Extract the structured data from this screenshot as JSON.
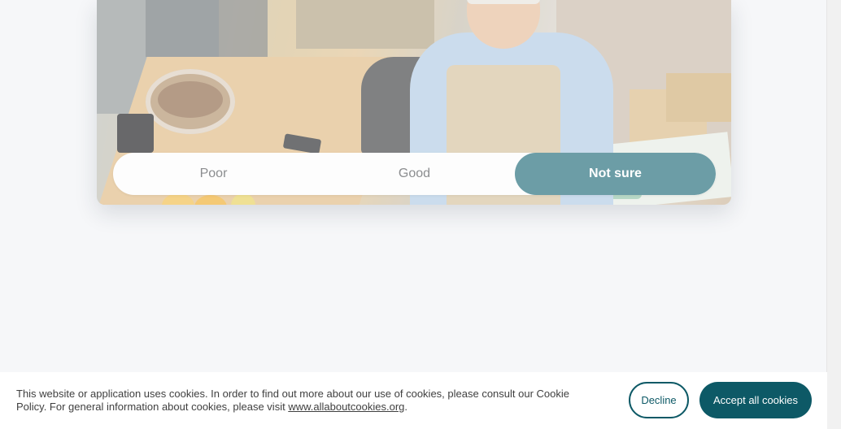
{
  "rating": {
    "options": [
      "Poor",
      "Good",
      "Not sure"
    ],
    "selected": "Not sure"
  },
  "cookie_banner": {
    "text_before_link": "This website or application uses cookies. In order to find out more about our use of cookies, please consult our Cookie Policy. For general information about cookies, please visit ",
    "link_text": "www.allaboutcookies.org",
    "text_after_link": ".",
    "decline_label": "Decline",
    "accept_label": "Accept all cookies"
  },
  "colors": {
    "page_background": "#f6f7f9",
    "selected_segment": "#6c9da6",
    "brand_teal": "#0d5966"
  }
}
